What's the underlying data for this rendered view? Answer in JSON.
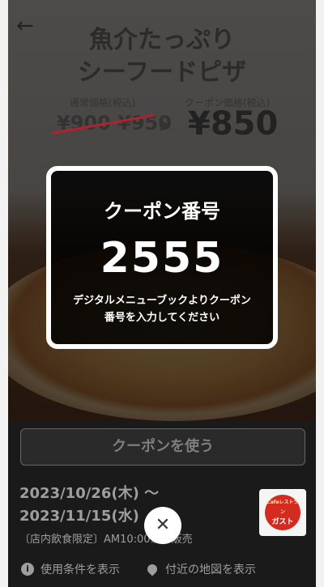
{
  "header": {
    "back_icon": "arrow-left-icon",
    "back_glyph": "←"
  },
  "coupon": {
    "title_line1": "魚介たっぷり",
    "title_line2": "シーフードピザ",
    "regular_label": "通常価格(税込)",
    "regular_price": "¥900 ¥950",
    "coupon_label": "クーポン価格(税込)",
    "coupon_price": "¥850"
  },
  "modal": {
    "title": "クーポン番号",
    "number": "2555",
    "message": "デジタルメニューブックよりクーポン番号を入力してください"
  },
  "actions": {
    "use_coupon_label": "クーポンを使う"
  },
  "validity": {
    "start": "2023/10/26(木) 〜",
    "end": "2023/11/15(水)",
    "note": "〔店内飲食限定〕AM10:00から販売"
  },
  "brand": {
    "logo_text": "ガスト",
    "logo_sub": "Cafeレストラン"
  },
  "close": {
    "glyph": "✕"
  },
  "footer": {
    "terms_label": "使用条件を表示",
    "map_label": "付近の地図を表示"
  },
  "colors": {
    "strike": "#b0232a",
    "logo_red": "#d42b20"
  }
}
